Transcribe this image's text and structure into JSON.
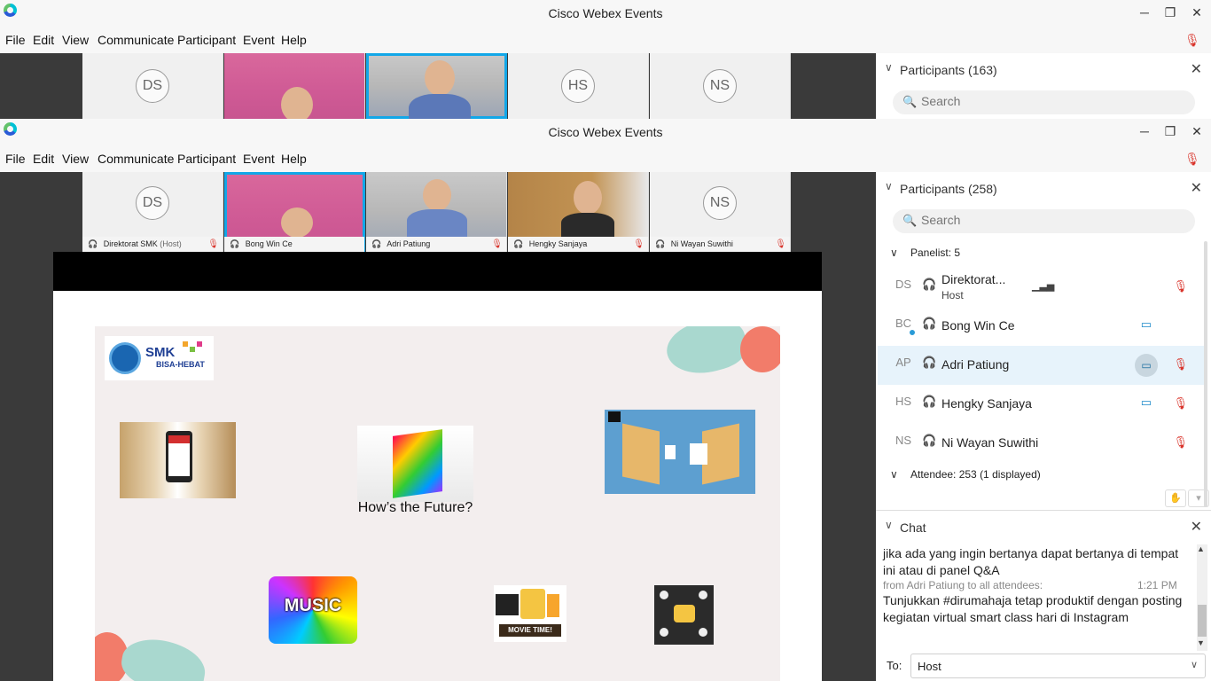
{
  "window": {
    "title": "Cisco Webex Events",
    "minimize": "─",
    "restore": "❐",
    "close": "✕"
  },
  "menu": [
    "File",
    "Edit",
    "View",
    "Communicate",
    "Participant",
    "Event",
    "Help"
  ],
  "back_window": {
    "participants_title": "Participants (163)",
    "tiles": [
      "DS",
      "HS",
      "NS"
    ]
  },
  "front_window": {
    "participants_title": "Participants (258)",
    "search_placeholder": "Search",
    "tiles": [
      {
        "initials": "DS",
        "name": "Direktorat SMK",
        "role": "(Host)"
      },
      {
        "name": "Bong Win Ce"
      },
      {
        "name": "Adri Patiung"
      },
      {
        "name": "Hengky Sanjaya"
      },
      {
        "initials": "NS",
        "name": "Ni Wayan Suwithi"
      }
    ],
    "panelist_header": "Panelist: 5",
    "panelists": [
      {
        "initials": "DS",
        "name": "Direktorat...",
        "sub": "Host"
      },
      {
        "initials": "BC",
        "name": "Bong Win Ce"
      },
      {
        "initials": "AP",
        "name": "Adri Patiung"
      },
      {
        "initials": "HS",
        "name": "Hengky Sanjaya"
      },
      {
        "initials": "NS",
        "name": "Ni Wayan Suwithi"
      }
    ],
    "attendee_header": "Attendee: 253 (1 displayed)",
    "chat": {
      "title": "Chat",
      "message1": "jika ada yang ingin bertanya dapat bertanya di tempat ini atau di panel Q&A",
      "from": "from Adri Patiung to all attendees:",
      "time": "1:21 PM",
      "message2": "Tunjukkan #dirumahaja tetap produktif dengan posting kegiatan virtual smart class hari di Instagram",
      "to_label": "To:",
      "to_value": "Host"
    }
  },
  "slide": {
    "logo_line1": "SMK",
    "logo_line2": "BISA-HEBAT",
    "caption": "How’s the Future?",
    "music": "MUSIC",
    "movie": "MOVIE TIME!"
  },
  "colors": {
    "accent": "#12a7e8",
    "mic_muted": "#d9342b",
    "slide_bg": "#f3eeee"
  }
}
